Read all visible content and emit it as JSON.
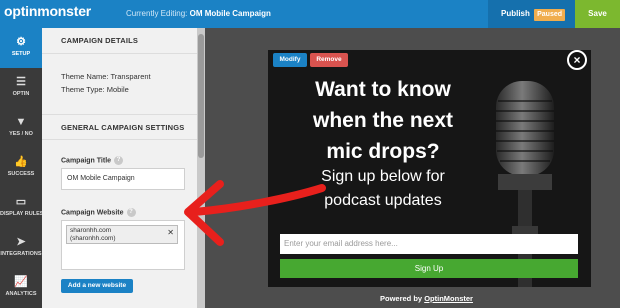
{
  "header": {
    "logo_text": "optinmonster",
    "editing_label": "Currently Editing:",
    "campaign_name": "OM Mobile Campaign",
    "publish_label": "Publish",
    "status_badge": "Paused",
    "save_label": "Save"
  },
  "nav": {
    "items": [
      {
        "label": "SETUP",
        "icon": "gear-icon",
        "active": true
      },
      {
        "label": "OPTIN",
        "icon": "list-icon"
      },
      {
        "label": "YES / NO",
        "icon": "filter-icon"
      },
      {
        "label": "SUCCESS",
        "icon": "thumbs-up-icon"
      },
      {
        "label": "DISPLAY RULES",
        "icon": "monitor-icon"
      },
      {
        "label": "INTEGRATIONS",
        "icon": "paper-plane-icon"
      },
      {
        "label": "ANALYTICS",
        "icon": "chart-icon"
      }
    ]
  },
  "panel": {
    "details_title": "CAMPAIGN DETAILS",
    "theme_name": "Theme Name: Transparent",
    "theme_type": "Theme Type: Mobile",
    "general_title": "GENERAL CAMPAIGN SETTINGS",
    "title_label": "Campaign Title",
    "title_value": "OM Mobile Campaign",
    "website_label": "Campaign Website",
    "website_tag_line1": "sharonhh.com",
    "website_tag_line2": "(sharonhh.com)",
    "add_website_label": "Add a new website"
  },
  "popup": {
    "modify_label": "Modify",
    "remove_label": "Remove",
    "close_glyph": "×",
    "headline_lines": [
      "Want to know",
      "when the next",
      "mic drops?"
    ],
    "subline_lines": [
      "Sign up below for",
      "podcast updates"
    ],
    "email_placeholder": "Enter your email address here...",
    "signup_label": "Sign Up",
    "powered_prefix": "Powered by",
    "powered_brand": "OptinMonster"
  },
  "colors": {
    "brand_blue": "#1b82c5",
    "save_green": "#7cb82f",
    "signup_green": "#47a831",
    "remove_red": "#d9534f",
    "paused_orange": "#f0ad4e",
    "annotation_red": "#e8201c"
  }
}
